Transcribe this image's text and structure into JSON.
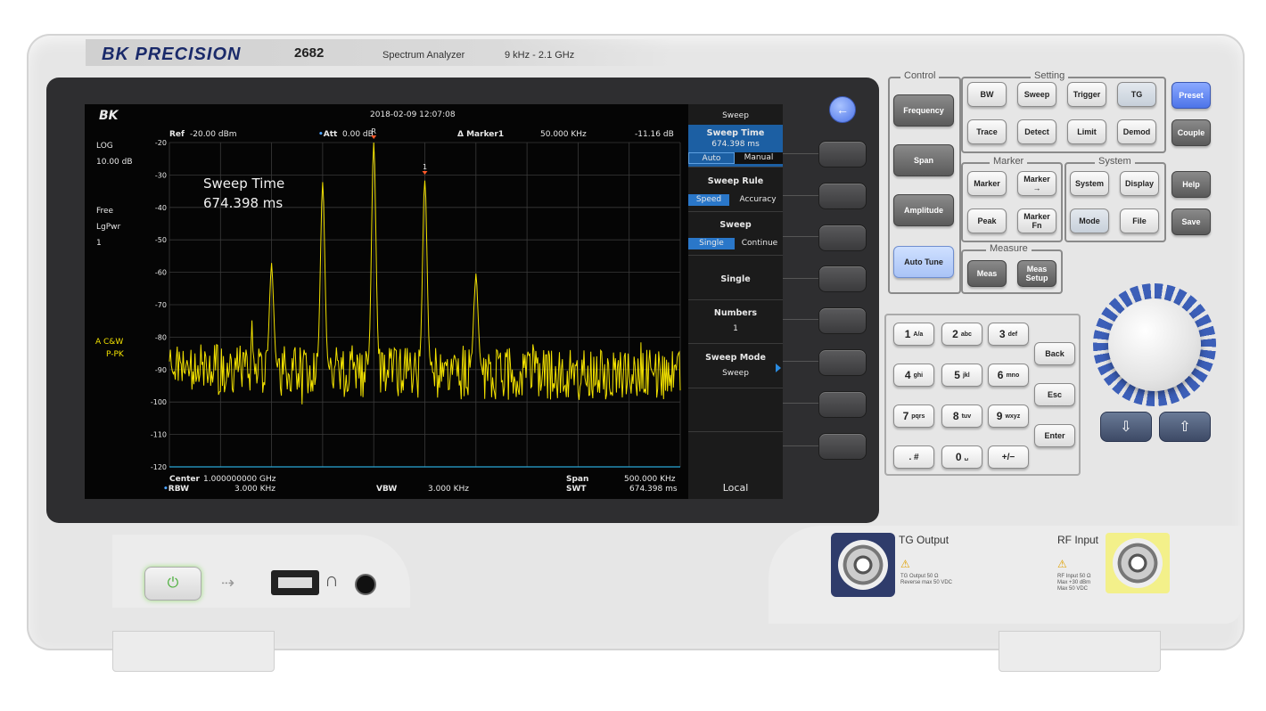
{
  "panel": {
    "brand": "BK PRECISION",
    "model": "2682",
    "type": "Spectrum Analyzer",
    "range": "9 kHz - 2.1 GHz"
  },
  "screen": {
    "logo": "BK",
    "datetime": "2018-02-09  12:07:08",
    "ref_label": "Ref",
    "ref_value": "-20.00 dBm",
    "att_label": "Att",
    "att_value": "0.00 dB",
    "marker_label": "Δ Marker1",
    "marker_freq": "50.000  KHz",
    "marker_amp": "-11.16 dB",
    "scale_mode": "LOG",
    "scale_div": "10.00 dB",
    "trig": "Free",
    "detect": "LgPwr",
    "avg": "1",
    "trace_a": "A  C&W",
    "trace_mode": "P-PK",
    "overlay_title": "Sweep Time",
    "overlay_value": "674.398 ms",
    "center_label": "Center",
    "center_value": "1.000000000  GHz",
    "rbw_label": "RBW",
    "rbw_value": "3.000  KHz",
    "vbw_label": "VBW",
    "vbw_value": "3.000  KHz",
    "span_label": "Span",
    "span_value": "500.000  KHz",
    "swt_label": "SWT",
    "swt_value": "674.398 ms",
    "marker_r": "R",
    "marker_1": "1"
  },
  "menu": {
    "title": "Sweep",
    "items": [
      {
        "title": "Sweep Time",
        "value": "674.398 ms",
        "opt_a": "Auto",
        "opt_b": "Manual"
      },
      {
        "title": "Sweep Rule",
        "opt_a": "Speed",
        "opt_b": "Accuracy"
      },
      {
        "title": "Sweep",
        "opt_a": "Single",
        "opt_b": "Continue"
      },
      {
        "title": "Single"
      },
      {
        "title": "Numbers",
        "value": "1"
      },
      {
        "title": "Sweep Mode",
        "value": "Sweep"
      }
    ],
    "footer": "Local"
  },
  "chart_data": {
    "type": "line",
    "xlabel": "",
    "ylabel": "",
    "y_ticks": [
      "-20",
      "-30",
      "-40",
      "-50",
      "-60",
      "-70",
      "-80",
      "-90",
      "-100",
      "-110",
      "-120"
    ],
    "ylim": [
      -120,
      -20
    ],
    "xlim": [
      999750,
      1000250
    ],
    "x_unit": "kHz",
    "grid": true,
    "peaks": [
      {
        "x": 999850,
        "y": -58
      },
      {
        "x": 999900,
        "y": -32
      },
      {
        "x": 999950,
        "y": -20
      },
      {
        "x": 1000000,
        "y": -31
      },
      {
        "x": 1000050,
        "y": -61
      }
    ],
    "noise_floor": -90,
    "trace_color": "#f2e100"
  },
  "groups": {
    "control": "Control",
    "setting": "Setting",
    "marker": "Marker",
    "system": "System",
    "measure": "Measure"
  },
  "keys": {
    "frequency": "Frequency",
    "span": "Span",
    "amplitude": "Amplitude",
    "autotune": "Auto Tune",
    "bw": "BW",
    "sweep": "Sweep",
    "trigger": "Trigger",
    "tg": "TG",
    "preset": "Preset",
    "trace": "Trace",
    "detect": "Detect",
    "limit": "Limit",
    "demod": "Demod",
    "couple": "Couple",
    "marker": "Marker",
    "marker_to": "Marker",
    "system": "System",
    "display": "Display",
    "help": "Help",
    "peak": "Peak",
    "marker_fn_1": "Marker",
    "marker_fn_2": "Fn",
    "mode": "Mode",
    "file": "File",
    "save": "Save",
    "meas": "Meas",
    "meas_setup_1": "Meas",
    "meas_setup_2": "Setup",
    "back": "Back",
    "esc": "Esc",
    "enter": "Enter"
  },
  "numpad": [
    {
      "main": "1",
      "sub": "A/a"
    },
    {
      "main": "2",
      "sub": "abc"
    },
    {
      "main": "3",
      "sub": "def"
    },
    {
      "main": "4",
      "sub": "ghi"
    },
    {
      "main": "5",
      "sub": "jkl"
    },
    {
      "main": "6",
      "sub": "mno"
    },
    {
      "main": "7",
      "sub": "pqrs"
    },
    {
      "main": "8",
      "sub": "tuv"
    },
    {
      "main": "9",
      "sub": "wxyz"
    },
    {
      "main": ". #",
      "sub": ""
    },
    {
      "main": "0",
      "sub": "␣"
    },
    {
      "main": "+/−",
      "sub": ""
    }
  ],
  "connectors": {
    "tg_label": "TG Output",
    "tg_note_1": "TG Output 50 Ω",
    "tg_note_2": "Reverse max 50 VDC",
    "rf_label": "RF Input",
    "rf_note_1": "RF Input 50 Ω",
    "rf_note_2": "Max +30 dBm",
    "rf_note_3": "Max 50 VDC"
  },
  "icons": {
    "power": "power-icon",
    "usb": "usb-icon",
    "headphone": "headphone-icon",
    "back_arrow": "back-arrow-icon",
    "arrow_down": "arrow-down-icon",
    "arrow_up": "arrow-up-icon",
    "warning": "warning-icon"
  },
  "colors": {
    "accent": "#4d74e8",
    "trace": "#f2e100",
    "menu_highlight": "#2a77c9"
  }
}
